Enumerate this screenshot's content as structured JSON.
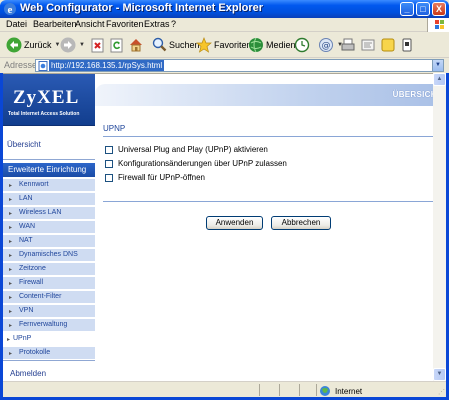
{
  "window": {
    "title": "Web Configurator - Microsoft Internet Explorer",
    "minimize": "_",
    "maximize": "□",
    "close": "X"
  },
  "menubar": {
    "items": [
      "Datei",
      "Bearbeiten",
      "Ansicht",
      "Favoriten",
      "Extras",
      "?"
    ]
  },
  "toolbar": {
    "back_label": "Zurück",
    "search_label": "Suchen",
    "favorites_label": "Favoriten",
    "media_label": "Medien"
  },
  "address": {
    "label": "Adresse",
    "url": "http://192.168.135.1/rpSys.html"
  },
  "logo": {
    "brand": "ZyXEL",
    "tagline": "Total Internet Access Solution"
  },
  "nav": {
    "overview": "Übersicht",
    "section": "Erweiterte Einrichtung",
    "items": [
      {
        "label": "Kennwort"
      },
      {
        "label": "LAN"
      },
      {
        "label": "Wireless LAN"
      },
      {
        "label": "WAN"
      },
      {
        "label": "NAT"
      },
      {
        "label": "Dynamisches DNS"
      },
      {
        "label": "Zeitzone"
      },
      {
        "label": "Firewall"
      },
      {
        "label": "Content-Filter"
      },
      {
        "label": "VPN"
      },
      {
        "label": "Fernverwaltung"
      },
      {
        "label": "UPnP",
        "active": true
      },
      {
        "label": "Protokolle"
      }
    ],
    "logout": "Abmelden"
  },
  "main": {
    "header": "ÜBERSICHT",
    "title": "UPNP",
    "options": [
      {
        "label": "Universal Plug and Play (UPnP) aktivieren",
        "checked": false
      },
      {
        "label": "Konfigurationsänderungen über UPnP zulassen",
        "checked": false
      },
      {
        "label": "Firewall für UPnP-öffnen",
        "checked": false
      }
    ],
    "apply_label": "Anwenden",
    "cancel_label": "Abbrechen"
  },
  "status": {
    "zone": "Internet"
  },
  "colors": {
    "titlebar": "#0058EE",
    "nav_section": "#2D66C9",
    "nav_item_bg": "#CFDCF2",
    "link_text": "#20469B"
  }
}
